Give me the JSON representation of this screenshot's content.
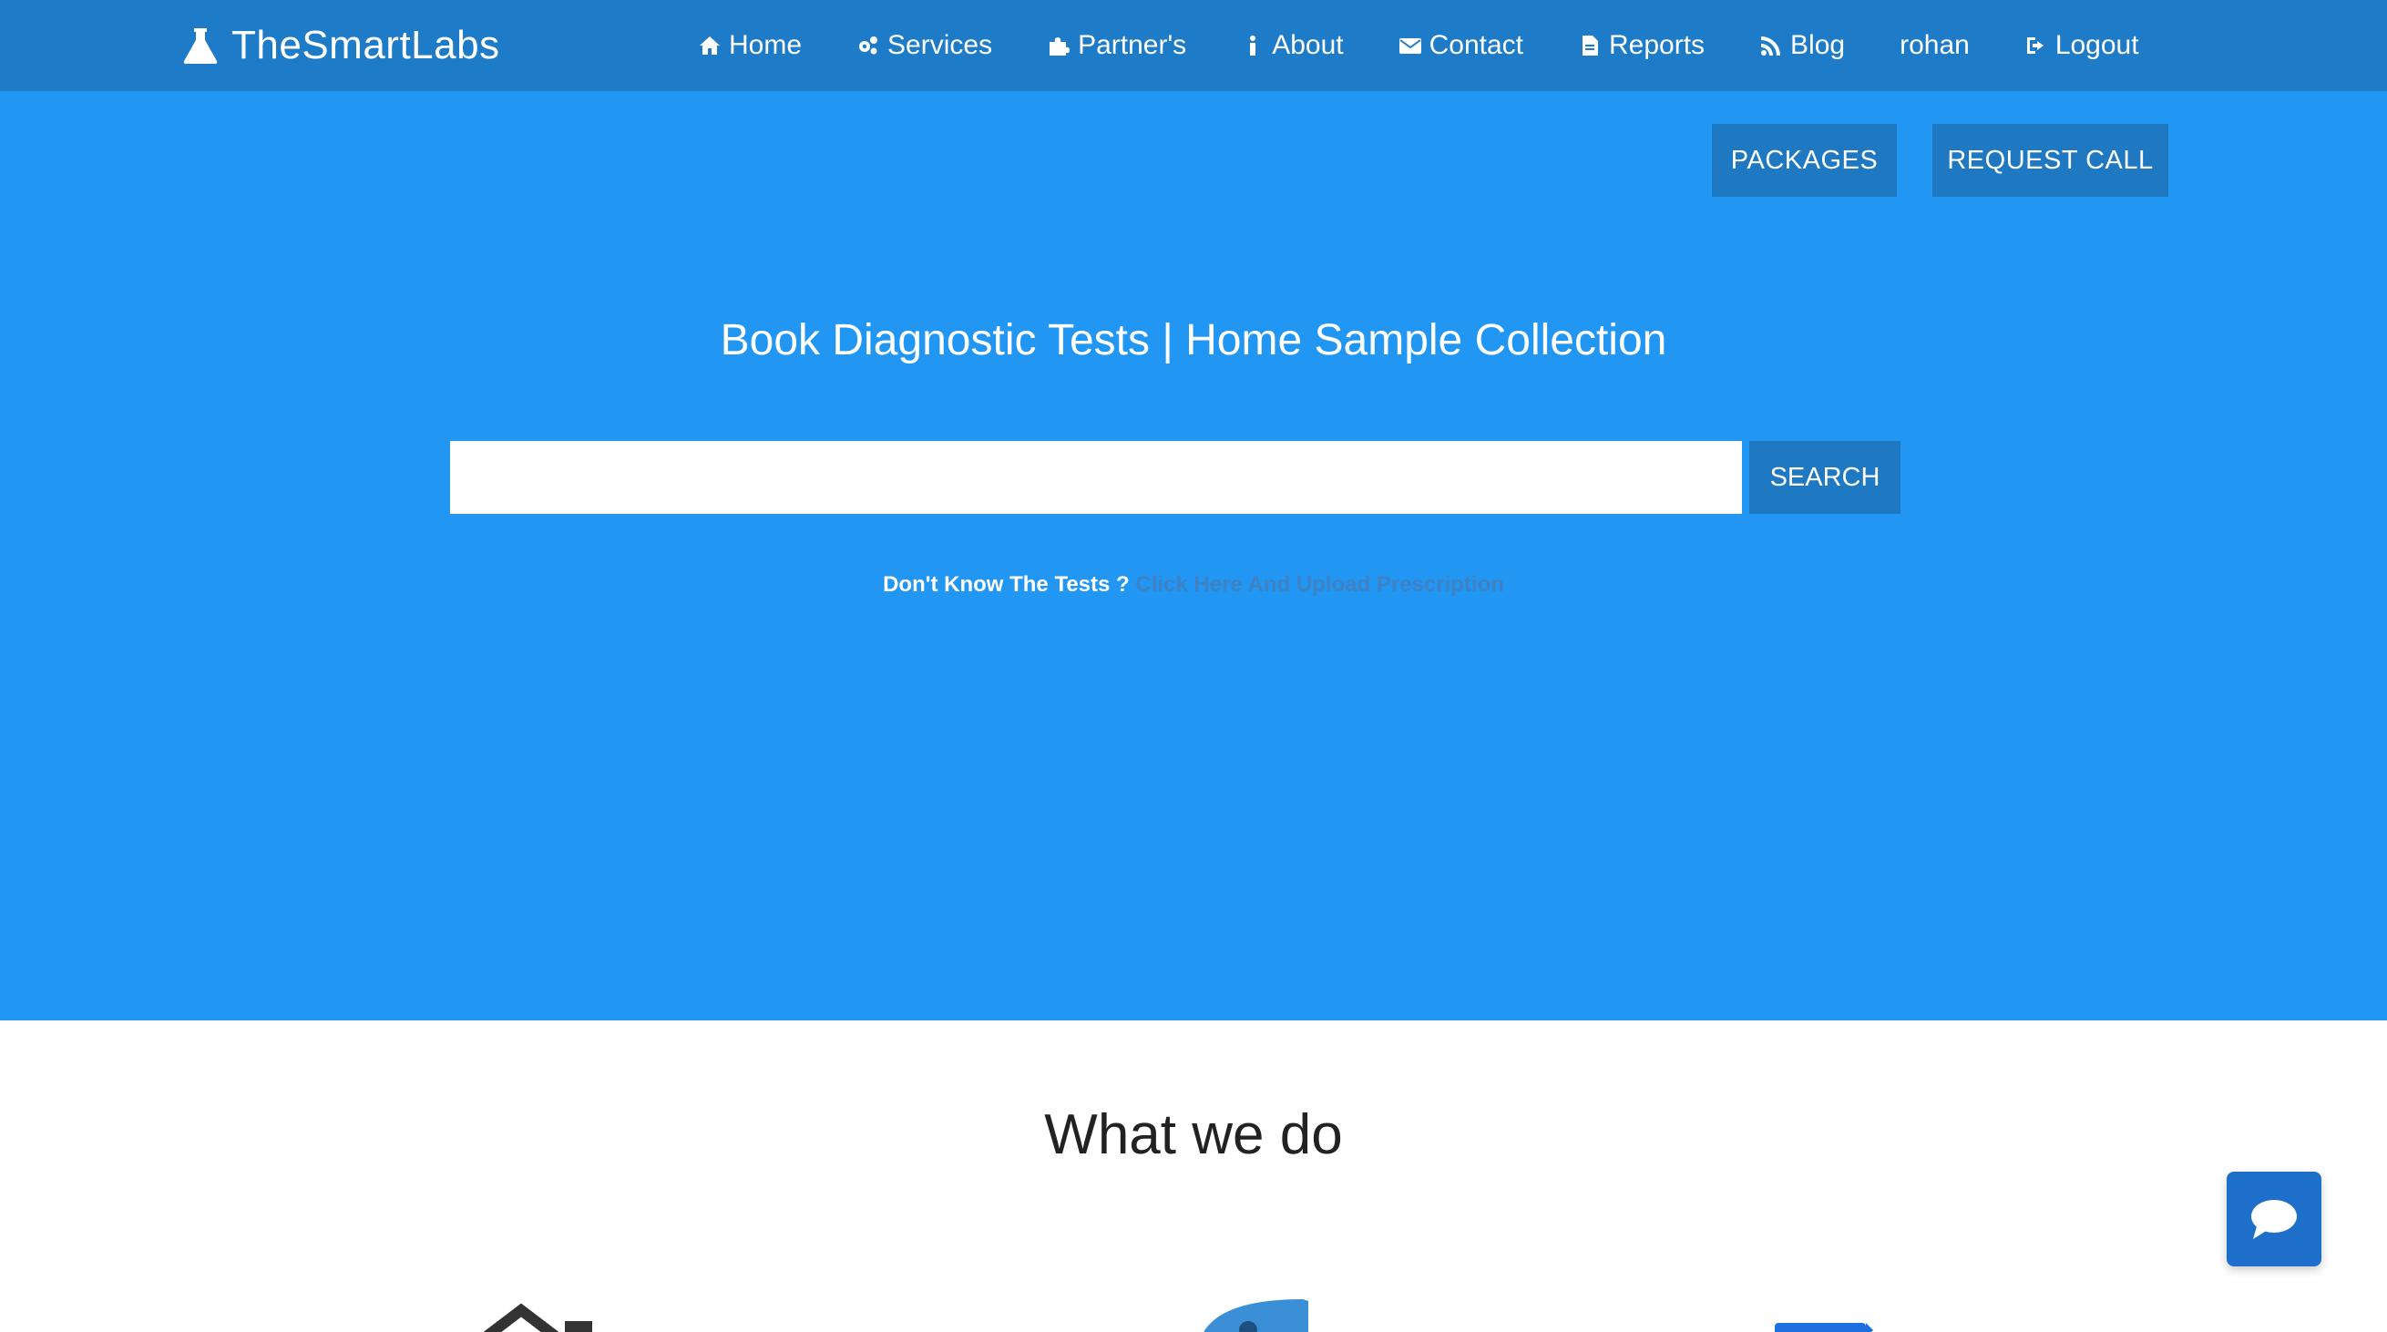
{
  "navbar": {
    "brand": "TheSmartLabs",
    "items": [
      {
        "label": "Home",
        "icon": "home-icon"
      },
      {
        "label": "Services",
        "icon": "cogs-icon"
      },
      {
        "label": "Partner's",
        "icon": "puzzle-icon"
      },
      {
        "label": "About",
        "icon": "info-icon"
      },
      {
        "label": "Contact",
        "icon": "envelope-icon"
      },
      {
        "label": "Reports",
        "icon": "file-icon"
      },
      {
        "label": "Blog",
        "icon": "rss-icon"
      },
      {
        "label": "rohan",
        "icon": ""
      },
      {
        "label": "Logout",
        "icon": "sign-out-icon"
      }
    ]
  },
  "hero": {
    "packages_label": "PACKAGES",
    "request_call_label": "REQUEST CALL",
    "title": "Book Diagnostic Tests | Home Sample Collection",
    "search": {
      "value": "",
      "placeholder": ""
    },
    "search_label": "SEARCH",
    "prescription_question": "Don't Know The Tests ?",
    "prescription_link": "Click Here And Upload Prescription"
  },
  "section": {
    "title": "What we do"
  },
  "colors": {
    "navbar": "#1e7bc7",
    "hero": "#2196f3",
    "button": "#1e78c2",
    "chat": "#1e6fc9"
  }
}
